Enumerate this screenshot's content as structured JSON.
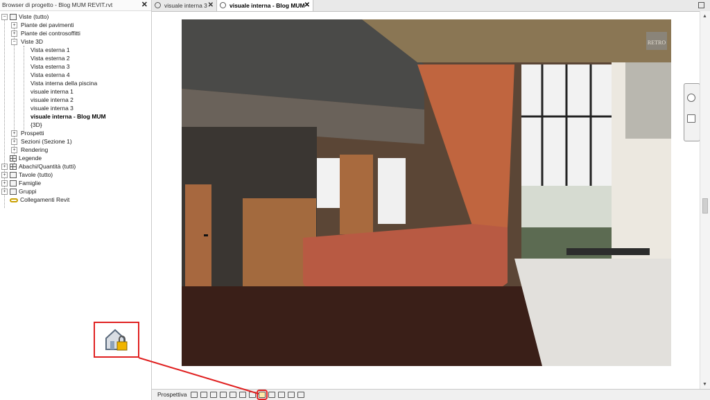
{
  "browser": {
    "title": "Browser di progetto - Blog MUM REVIT.rvt",
    "close_label": "✕",
    "nodes": {
      "viste": "Viste (tutto)",
      "piante_pavimenti": "Piante dei pavimenti",
      "piante_controsoffitti": "Piante dei controsoffitti",
      "viste3d": "Viste 3D",
      "vista_esterna_1": "Vista esterna 1",
      "vista_esterna_2": "Vista esterna 2",
      "vista_esterna_3": "Vista esterna 3",
      "vista_esterna_4": "Vista esterna 4",
      "vista_interna_piscina": "Vista interna della piscina",
      "visuale_interna_1": "visuale interna 1",
      "visuale_interna_2": "visuale interna 2",
      "visuale_interna_3": "visuale interna 3",
      "visuale_interna_blog": "visuale interna - Blog MUM",
      "view_3d": "{3D}",
      "prospetti": "Prospetti",
      "sezioni": "Sezioni (Sezione 1)",
      "rendering": "Rendering",
      "legende": "Legende",
      "abachi": "Abachi/Quantità (tutti)",
      "tavole": "Tavole (tutto)",
      "famiglie": "Famiglie",
      "gruppi": "Gruppi",
      "collegamenti": "Collegamenti Revit"
    }
  },
  "tabs": [
    {
      "label": "visuale interna 3",
      "close": "✕"
    },
    {
      "label": "visuale interna - Blog MUM",
      "close": "✕"
    }
  ],
  "viewport": {
    "watermark": "RETRO"
  },
  "statusbar": {
    "view_type": "Prospettiva"
  },
  "colors": {
    "accent_highlight": "#e02020",
    "stair": "#b85a43",
    "floor": "#3a1f18"
  },
  "icons": [
    "house-lock-icon",
    "view-cube-icon",
    "zoom-icon"
  ]
}
